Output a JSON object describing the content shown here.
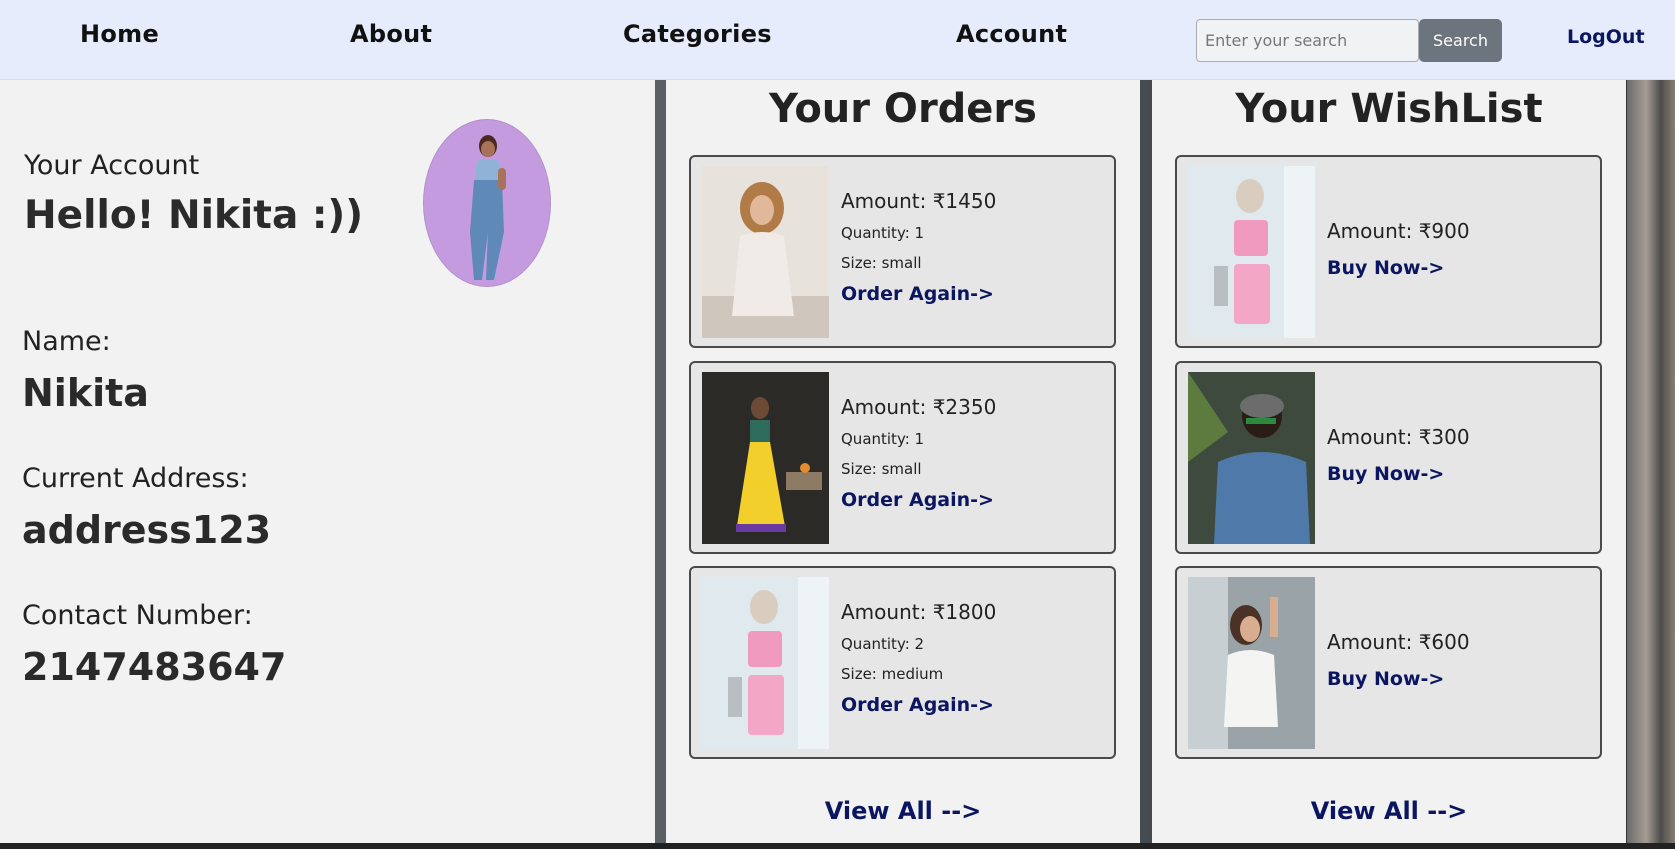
{
  "nav": {
    "home": "Home",
    "about": "About",
    "categories": "Categories",
    "account": "Account",
    "search_placeholder": "Enter your search",
    "search_button": "Search",
    "logout": "LogOut"
  },
  "account": {
    "heading": "Your Account",
    "greeting": "Hello! Nikita :))",
    "name_label": "Name:",
    "name_value": "Nikita",
    "address_label": "Current Address:",
    "address_value": "address123",
    "contact_label": "Contact Number:",
    "contact_value": "2147483647"
  },
  "orders": {
    "title": "Your Orders",
    "items": [
      {
        "amount": "Amount: ₹1450",
        "quantity": "Quantity: 1",
        "size": "Size: small",
        "action": "Order Again->"
      },
      {
        "amount": "Amount: ₹2350",
        "quantity": "Quantity: 1",
        "size": "Size: small",
        "action": "Order Again->"
      },
      {
        "amount": "Amount: ₹1800",
        "quantity": "Quantity: 2",
        "size": "Size: medium",
        "action": "Order Again->"
      }
    ],
    "view_all": "View All -->"
  },
  "wishlist": {
    "title": "Your WishList",
    "items": [
      {
        "amount": "Amount: ₹900",
        "action": "Buy Now->"
      },
      {
        "amount": "Amount: ₹300",
        "action": "Buy Now->"
      },
      {
        "amount": "Amount: ₹600",
        "action": "Buy Now->"
      }
    ],
    "view_all": "View All -->"
  }
}
